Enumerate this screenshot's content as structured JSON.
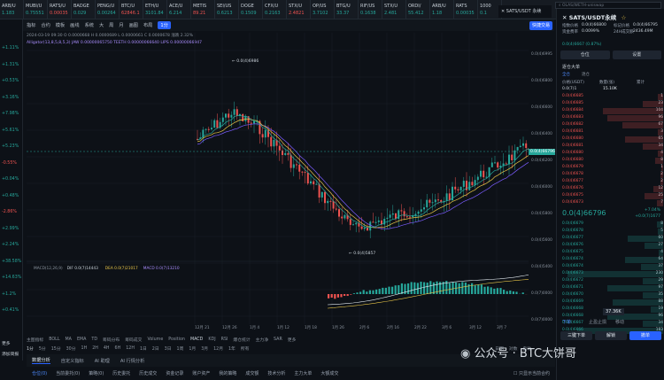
{
  "tickers": [
    {
      "name": "ARB/U",
      "price": "1.183",
      "dir": "up"
    },
    {
      "name": "MUBI/U",
      "price": "0.75551",
      "dir": "up"
    },
    {
      "name": "RATS/U",
      "price": "0.00035",
      "dir": "dn"
    },
    {
      "name": "BADGE",
      "price": "0.029",
      "dir": "up"
    },
    {
      "name": "PENG/U",
      "price": "0.00264",
      "dir": "up"
    },
    {
      "name": "BTC/U",
      "price": "62846.1",
      "dir": "dn"
    },
    {
      "name": "ETH/U",
      "price": "3101.84",
      "dir": "up"
    },
    {
      "name": "ACE/U",
      "price": "6.214",
      "dir": "up"
    },
    {
      "name": "METIS",
      "price": "89.21",
      "dir": "dn"
    },
    {
      "name": "SEI/US",
      "price": "0.6213",
      "dir": "up"
    },
    {
      "name": "DOGE",
      "price": "0.1509",
      "dir": "up"
    },
    {
      "name": "CFX/U",
      "price": "0.2163",
      "dir": "up"
    },
    {
      "name": "STX/U",
      "price": "2.4821",
      "dir": "dn"
    },
    {
      "name": "OP/US",
      "price": "3.7102",
      "dir": "up"
    },
    {
      "name": "BTG/U",
      "price": "33.37",
      "dir": "up"
    },
    {
      "name": "RIF/US",
      "price": "0.1638",
      "dir": "up"
    },
    {
      "name": "STX/U",
      "price": "2.481",
      "dir": "up"
    },
    {
      "name": "ORDI/",
      "price": "55.412",
      "dir": "up"
    },
    {
      "name": "ARB/U",
      "price": "1.18",
      "dir": "up"
    },
    {
      "name": "RATS",
      "price": "0.00035",
      "dir": "up"
    },
    {
      "name": "1000",
      "price": "0.1",
      "dir": "up"
    }
  ],
  "active_tab": "SATS/USDT 永续",
  "search_placeholder": "OLAS/WETH-uniswap",
  "toolbar": {
    "items": [
      "指标",
      "合约",
      "模板",
      "画线",
      "系统",
      "大",
      "周",
      "月",
      "画图",
      "布局"
    ],
    "timeframe": "1分",
    "trade_button": "快捷交易"
  },
  "chart_info": {
    "line1": "2024-03-19 09:30  O 0.0000668  H 0.0000689  L 0.0000661  C 0.0000678  涨跌 2.32%",
    "line2": "Alligator(13,8,5,8,5,3)  JAW 0.00000065750  TEETH 0.00000066640  LIPS 0.00000066947",
    "high_marker": "0.0(4)6986",
    "low_marker": "0.0(4)5857",
    "macd_label": "MACD(12,26,9)",
    "dif": "DIF 0.0(7)14443",
    "dea": "DEA 0.0(7)21017",
    "macd": "MACD 0.0(7)13210"
  },
  "left_changes": [
    {
      "v": "+1.11%",
      "dir": "up"
    },
    {
      "v": "+1.31%",
      "dir": "up"
    },
    {
      "v": "+0.53%",
      "dir": "up"
    },
    {
      "v": "+3.16%",
      "dir": "up"
    },
    {
      "v": "+7.98%",
      "dir": "up"
    },
    {
      "v": "+5.61%",
      "dir": "up"
    },
    {
      "v": "+5.23%",
      "dir": "up"
    },
    {
      "v": "-0.55%",
      "dir": "dn"
    },
    {
      "v": "+0.04%",
      "dir": "up"
    },
    {
      "v": "+0.48%",
      "dir": "up"
    },
    {
      "v": "-2.86%",
      "dir": "dn"
    },
    {
      "v": "+2.99%",
      "dir": "up"
    },
    {
      "v": "+2.24%",
      "dir": "up"
    },
    {
      "v": "+38.58%",
      "dir": "up"
    },
    {
      "v": "+14.63%",
      "dir": "up"
    },
    {
      "v": "+1.2%",
      "dir": "up"
    },
    {
      "v": "+0.41%",
      "dir": "up"
    }
  ],
  "left_bottom": [
    "更多",
    "添加简报"
  ],
  "price_axis": [
    "0.0(4)6995",
    "0.0(4)6800",
    "0.0(4)6600",
    "0.0(4)6400",
    "0.0(4)6200",
    "0.0(4)6000",
    "0.0(4)5800",
    "0.0(4)5600",
    "0.0(4)5400",
    "0.0(7)0000",
    "0.0(7)0000"
  ],
  "current_price": "0.0(4)66796",
  "time_axis": [
    "12月 21",
    "12月 26",
    "1月 4",
    "1月 12",
    "1月 18",
    "1月 26",
    "2月 6",
    "2月 16",
    "2月 22",
    "3月 6",
    "3月 12",
    "3月 7"
  ],
  "indicator_tabs": [
    "主图指标",
    "BOLL",
    "MA",
    "EMA",
    "TD",
    "筹码分布",
    "筹码成交",
    "Volume",
    "Position",
    "MACD",
    "KDJ",
    "RSI",
    "爆仓统计",
    "主力净",
    "SAR",
    "更多"
  ],
  "active_indicator": "MACD",
  "ranges": [
    "1分",
    "5分",
    "15分",
    "30分",
    "1H",
    "2H",
    "4H",
    "6H",
    "12H",
    "1日",
    "2日",
    "3日",
    "1周",
    "1月",
    "3月",
    "12月",
    "1年",
    "所有"
  ],
  "ranges_right": [
    "日期",
    "对数",
    "自动"
  ],
  "bottom_tabs": [
    "数据分析",
    "自定义指标",
    "AI 助理",
    "AI 行情分析"
  ],
  "active_bottom_tab": "数据分析",
  "bottom_sub": [
    "仓位(0)",
    "当前委托(0)",
    "策略(0)",
    "历史委托",
    "历史成交",
    "资金记录",
    "账户资产",
    "我的策略",
    "成交额",
    "技术分析",
    "主力大单",
    "大额成交"
  ],
  "bottom_checkbox": "只显示当前合约",
  "panel": {
    "title": "SATS/USDT永续",
    "fav_label": "☆",
    "fields": [
      {
        "k": "指数价格",
        "v": "0.0(4)66800"
      },
      {
        "k": "标记价格",
        "v": "0.0(4)66795"
      },
      {
        "k": "资金费率",
        "v": "0.0099%"
      },
      {
        "k": "24H成交额",
        "v": "2436.49M"
      }
    ],
    "change": "0.0(4)6667 (0.87%)",
    "buttons_top": [
      "仓位",
      "设置"
    ],
    "book_title": "逐仓大单",
    "tabs": [
      "全仓",
      "逐仓"
    ],
    "book_header": [
      "价格(USDT)",
      "数量(张)",
      "累计"
    ],
    "book_group": "0.0(7)1",
    "spread": "15.10K",
    "asks": [
      {
        "p": "0.0(4)6685",
        "q": "1",
        "s": 0.05
      },
      {
        "p": "0.0(4)6685",
        "q": "23",
        "s": 0.2
      },
      {
        "p": "0.0(4)6684",
        "q": "104",
        "s": 0.6
      },
      {
        "p": "0.0(4)6683",
        "q": "96",
        "s": 0.55
      },
      {
        "p": "0.0(4)6682",
        "q": "67",
        "s": 0.4
      },
      {
        "p": "0.0(4)6681",
        "q": "3",
        "s": 0.05
      },
      {
        "p": "0.0(4)6680",
        "q": "65",
        "s": 0.38
      },
      {
        "p": "0.0(4)6681",
        "q": "34",
        "s": 0.2
      },
      {
        "p": "0.0(4)6680",
        "q": "4",
        "s": 0.05
      },
      {
        "p": "0.0(4)6680",
        "q": "8",
        "s": 0.08
      },
      {
        "p": "0.0(4)6679",
        "q": "1",
        "s": 0.02
      },
      {
        "p": "0.0(4)6678",
        "q": "2",
        "s": 0.03
      },
      {
        "p": "0.0(4)6677",
        "q": "2",
        "s": 0.03
      },
      {
        "p": "0.0(4)6676",
        "q": "12",
        "s": 0.1
      },
      {
        "p": "0.0(4)6675",
        "q": "25",
        "s": 0.18
      },
      {
        "p": "0.0(4)6673",
        "q": "7",
        "s": 0.06
      }
    ],
    "last_price": "0.0(4)66796",
    "last_change": "+7.04%",
    "last_sub": "+0.0(7)1677",
    "bids": [
      {
        "p": "0.0(4)6679",
        "q": "8",
        "s": 0.06
      },
      {
        "p": "0.0(4)6678",
        "q": "5",
        "s": 0.05
      },
      {
        "p": "0.0(4)6677",
        "q": "60",
        "s": 0.35
      },
      {
        "p": "0.0(4)6676",
        "q": "27",
        "s": 0.18
      },
      {
        "p": "0.0(4)6675",
        "q": "4",
        "s": 0.04
      },
      {
        "p": "0.0(4)6674",
        "q": "64",
        "s": 0.38
      },
      {
        "p": "0.0(4)6674",
        "q": "37",
        "s": 0.22
      },
      {
        "p": "0.0(4)6673",
        "q": "230",
        "s": 0.95
      },
      {
        "p": "0.0(4)6672",
        "q": "29",
        "s": 0.2
      },
      {
        "p": "0.0(4)6671",
        "q": "97",
        "s": 0.55
      },
      {
        "p": "0.0(4)6670",
        "q": "35",
        "s": 0.2
      },
      {
        "p": "0.0(4)6669",
        "q": "88",
        "s": 0.5
      },
      {
        "p": "0.0(4)6668",
        "q": "19",
        "s": 0.12
      },
      {
        "p": "0.0(4)6668",
        "q": "96",
        "s": 0.55
      },
      {
        "p": "0.0(4)6667",
        "q": "34",
        "s": 0.2
      },
      {
        "p": "0.0(4)6666",
        "q": "183",
        "s": 0.85
      }
    ],
    "depth_total": "37.36K",
    "order_tabs": [
      "下单",
      "止盈止损",
      "移动"
    ],
    "buttons_bottom": [
      "三键下单",
      "解锁",
      "撤单"
    ]
  },
  "watermark": "公众号 · BTC大饼哥",
  "colors": {
    "up": "#26a69a",
    "down": "#ef5350",
    "accent": "#2962ff",
    "jaw": "#7b5cff",
    "teeth": "#e8c547",
    "lips": "#26a69a"
  }
}
